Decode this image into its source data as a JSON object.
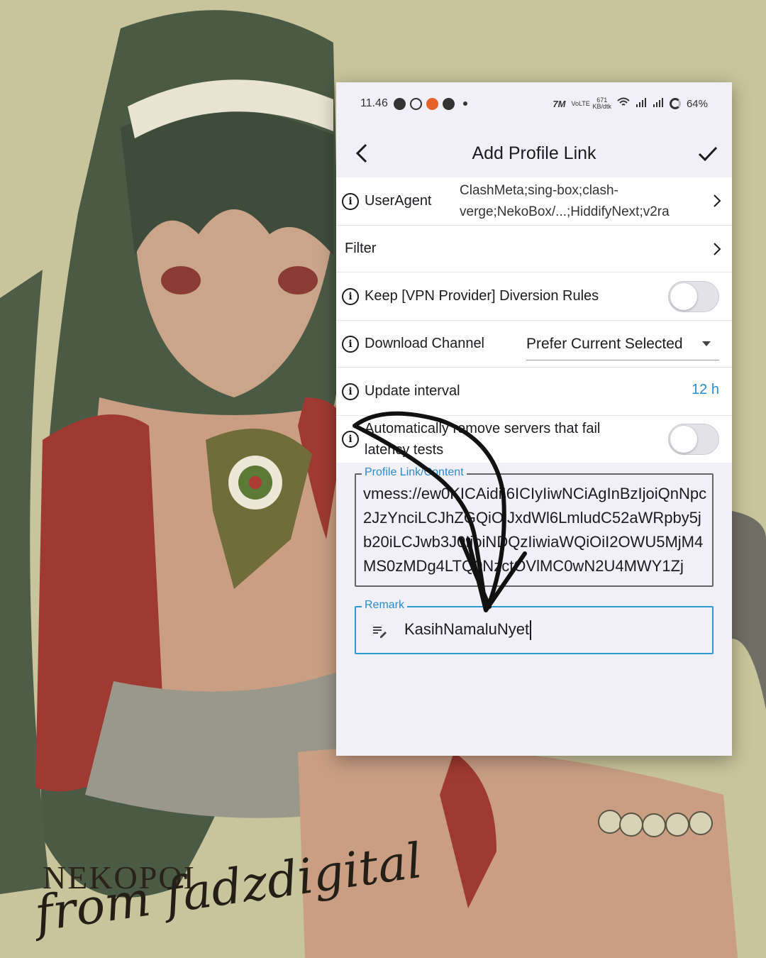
{
  "status_bar": {
    "time": "11.46",
    "network_speed": "671",
    "network_unit": "KB/dtk",
    "volte": "VoLTE",
    "battery": "64%"
  },
  "app_bar": {
    "title": "Add Profile Link",
    "back_icon": "arrow-back-icon",
    "confirm_icon": "check-icon"
  },
  "settings": {
    "user_agent": {
      "label": "UserAgent",
      "value": "ClashMeta;sing-box;clash-verge;NekoBox/...;HiddifyNext;v2ra"
    },
    "filter": {
      "label": "Filter"
    },
    "keep_rules": {
      "label": "Keep [VPN Provider] Diversion Rules",
      "enabled": false
    },
    "download_channel": {
      "label": "Download Channel",
      "selected": "Prefer Current Selected"
    },
    "update_interval": {
      "label": "Update interval",
      "value": "12 h"
    },
    "auto_remove": {
      "label": "Automatically remove servers that fail latency tests",
      "enabled": false
    }
  },
  "profile_link": {
    "label": "Profile Link/Content",
    "value": "vmess://ew0KICAidiI6ICIyIiwNCiAgInBzIjoiQnNpc2JzYnciLCJhZGQiOiJxdWl6LmludC52aWRpby5jb20iLCJwb3J0IjoiNDQzIiwiaWQiOiI2OWU5MjM4MS0zMDg4LTQ0NzctOVlMC0wN2U4MWY1Zj"
  },
  "remark": {
    "label": "Remark",
    "value": "KasihNamaluNyet"
  },
  "overlay": {
    "brand": "NEKOPOI",
    "signature": "from fadzdigital"
  },
  "colors": {
    "accent": "#2a8bd1",
    "background": "#c9c49a",
    "card": "#f1f0f6"
  }
}
